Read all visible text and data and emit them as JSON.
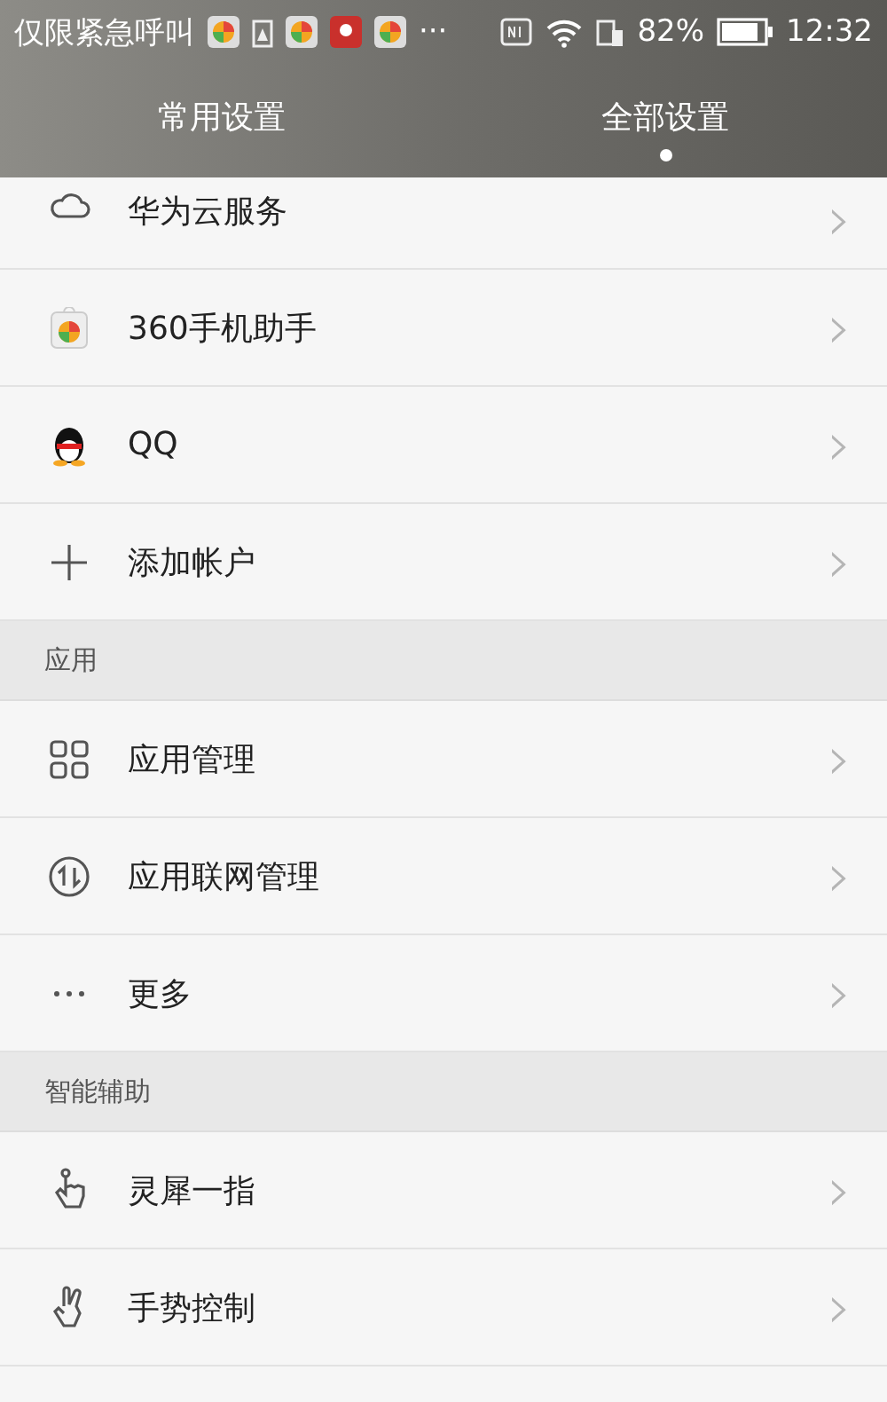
{
  "status_bar": {
    "carrier": "仅限紧急呼叫",
    "more": "···",
    "battery": "82%",
    "time": "12:32"
  },
  "tabs": [
    {
      "label": "常用设置",
      "selected": false
    },
    {
      "label": "全部设置",
      "selected": true
    }
  ],
  "items": [
    {
      "kind": "row",
      "label": "华为云服务",
      "chevron": "›"
    },
    {
      "kind": "row",
      "label": "360手机助手",
      "chevron": "›"
    },
    {
      "kind": "row",
      "label": "QQ",
      "chevron": "›"
    },
    {
      "kind": "row",
      "label": "添加帐户",
      "chevron": "›"
    },
    {
      "kind": "header",
      "label": "应用"
    },
    {
      "kind": "row",
      "label": "应用管理",
      "chevron": "›"
    },
    {
      "kind": "row",
      "label": "应用联网管理",
      "chevron": "›"
    },
    {
      "kind": "row",
      "label": "更多",
      "chevron": "›"
    },
    {
      "kind": "header",
      "label": "智能辅助"
    },
    {
      "kind": "row",
      "label": "灵犀一指",
      "chevron": "›"
    },
    {
      "kind": "row",
      "label": "手势控制",
      "chevron": "›"
    }
  ]
}
